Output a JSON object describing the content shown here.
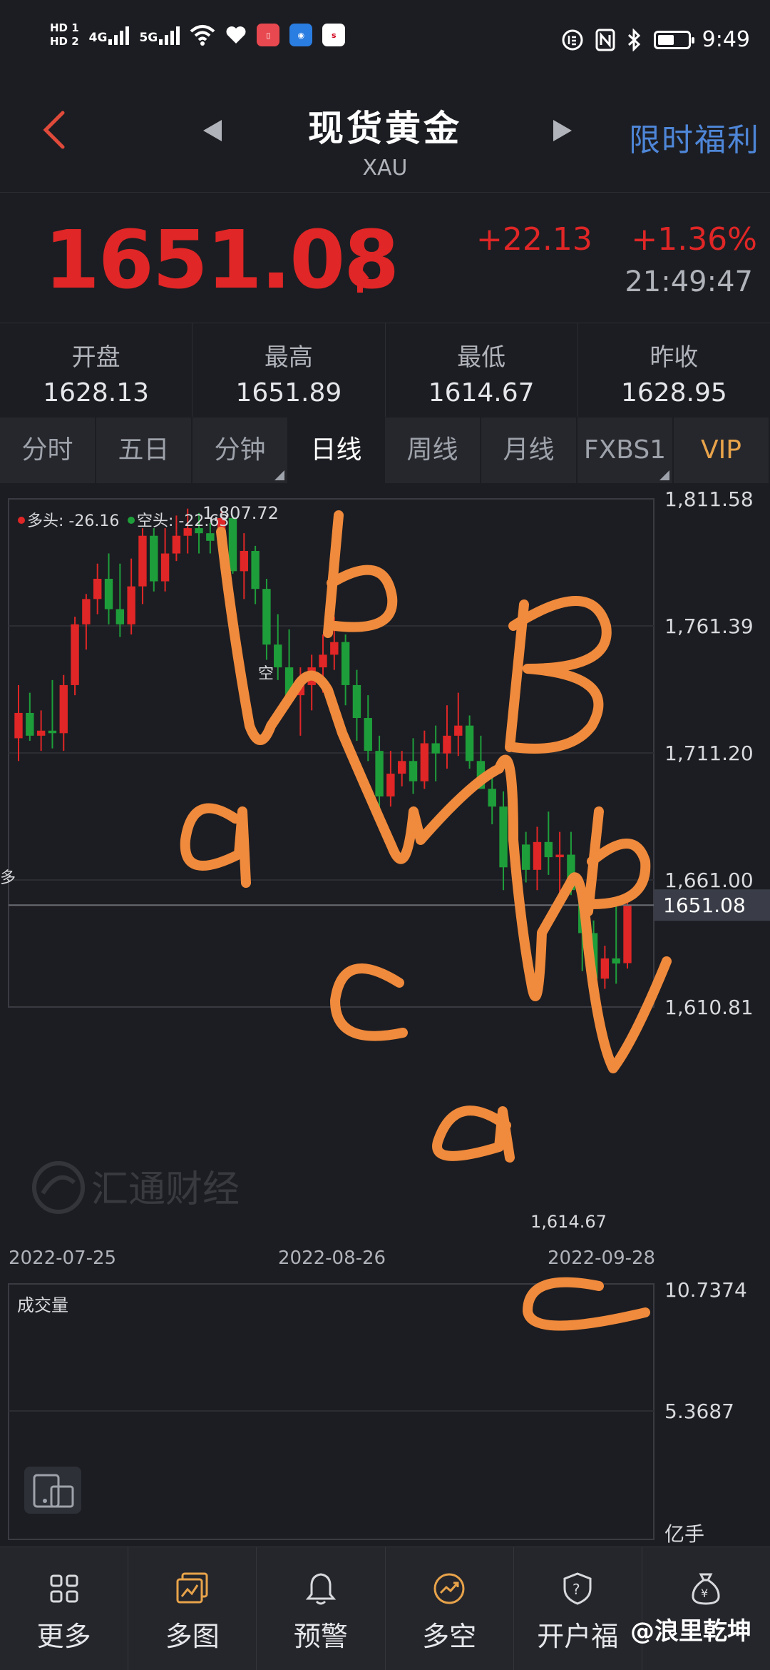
{
  "status_bar": {
    "hd1": "HD 1",
    "hd2": "HD 2",
    "net1": "4G",
    "net2": "5G",
    "time": "9:49"
  },
  "header": {
    "title": "现货黄金",
    "subtitle": "XAU",
    "promo": "限时福利"
  },
  "quote": {
    "price": "1651.08",
    "change": "+22.13",
    "change_pct": "+1.36%",
    "time": "21:49:47"
  },
  "stats": [
    {
      "label": "开盘",
      "value": "1628.13"
    },
    {
      "label": "最高",
      "value": "1651.89"
    },
    {
      "label": "最低",
      "value": "1614.67"
    },
    {
      "label": "昨收",
      "value": "1628.95"
    }
  ],
  "tabs": [
    "分时",
    "五日",
    "分钟",
    "日线",
    "周线",
    "月线",
    "FXBS1",
    "VIP"
  ],
  "chart_labels": {
    "long_legend": "多头: -26.16",
    "short_legend": "空头: -22.63",
    "high_mark": "1,807.72",
    "low_mark": "1,614.67",
    "kong_mark": "空",
    "duo_mark": "多",
    "current_tag": "1651.08",
    "watermark": "汇通财经",
    "volume_title": "成交量",
    "vol_unit": "亿手"
  },
  "chart_data": {
    "type": "candlestick",
    "y_ticks": [
      "1,811.58",
      "1,761.39",
      "1,711.20",
      "1,661.00",
      "1,610.81"
    ],
    "x_ticks": [
      "2022-07-25",
      "2022-08-26",
      "2022-09-28"
    ],
    "volume_ticks": [
      "10.7374",
      "5.3687"
    ],
    "ylim": [
      1610.81,
      1811.58
    ],
    "current": 1651.08,
    "candles": [
      {
        "o": 1717,
        "h": 1738,
        "l": 1708,
        "c": 1727
      },
      {
        "o": 1727,
        "h": 1735,
        "l": 1716,
        "c": 1718
      },
      {
        "o": 1718,
        "h": 1728,
        "l": 1712,
        "c": 1720
      },
      {
        "o": 1720,
        "h": 1740,
        "l": 1713,
        "c": 1719
      },
      {
        "o": 1719,
        "h": 1742,
        "l": 1712,
        "c": 1738
      },
      {
        "o": 1738,
        "h": 1765,
        "l": 1734,
        "c": 1762
      },
      {
        "o": 1762,
        "h": 1774,
        "l": 1752,
        "c": 1772
      },
      {
        "o": 1772,
        "h": 1786,
        "l": 1766,
        "c": 1780
      },
      {
        "o": 1780,
        "h": 1790,
        "l": 1762,
        "c": 1768
      },
      {
        "o": 1768,
        "h": 1786,
        "l": 1757,
        "c": 1762
      },
      {
        "o": 1762,
        "h": 1788,
        "l": 1758,
        "c": 1777
      },
      {
        "o": 1777,
        "h": 1800,
        "l": 1770,
        "c": 1797
      },
      {
        "o": 1797,
        "h": 1800,
        "l": 1775,
        "c": 1779
      },
      {
        "o": 1779,
        "h": 1800,
        "l": 1775,
        "c": 1790
      },
      {
        "o": 1790,
        "h": 1805,
        "l": 1787,
        "c": 1797
      },
      {
        "o": 1797,
        "h": 1807.72,
        "l": 1790,
        "c": 1800
      },
      {
        "o": 1800,
        "h": 1806,
        "l": 1790,
        "c": 1798
      },
      {
        "o": 1798,
        "h": 1802,
        "l": 1790,
        "c": 1795
      },
      {
        "o": 1795,
        "h": 1807,
        "l": 1787,
        "c": 1804
      },
      {
        "o": 1804,
        "h": 1805,
        "l": 1782,
        "c": 1783
      },
      {
        "o": 1783,
        "h": 1798,
        "l": 1772,
        "c": 1791
      },
      {
        "o": 1791,
        "h": 1793,
        "l": 1770,
        "c": 1776
      },
      {
        "o": 1776,
        "h": 1780,
        "l": 1748,
        "c": 1754
      },
      {
        "o": 1754,
        "h": 1766,
        "l": 1740,
        "c": 1745
      },
      {
        "o": 1745,
        "h": 1760,
        "l": 1733,
        "c": 1734
      },
      {
        "o": 1734,
        "h": 1745,
        "l": 1718,
        "c": 1738
      },
      {
        "o": 1738,
        "h": 1750,
        "l": 1728,
        "c": 1745
      },
      {
        "o": 1745,
        "h": 1758,
        "l": 1735,
        "c": 1750
      },
      {
        "o": 1750,
        "h": 1765,
        "l": 1744,
        "c": 1755
      },
      {
        "o": 1755,
        "h": 1758,
        "l": 1730,
        "c": 1738
      },
      {
        "o": 1738,
        "h": 1744,
        "l": 1716,
        "c": 1725
      },
      {
        "o": 1725,
        "h": 1734,
        "l": 1708,
        "c": 1712
      },
      {
        "o": 1712,
        "h": 1718,
        "l": 1688,
        "c": 1694
      },
      {
        "o": 1694,
        "h": 1712,
        "l": 1690,
        "c": 1703
      },
      {
        "o": 1703,
        "h": 1712,
        "l": 1698,
        "c": 1708
      },
      {
        "o": 1708,
        "h": 1717,
        "l": 1695,
        "c": 1700
      },
      {
        "o": 1700,
        "h": 1720,
        "l": 1697,
        "c": 1715
      },
      {
        "o": 1715,
        "h": 1722,
        "l": 1700,
        "c": 1711
      },
      {
        "o": 1711,
        "h": 1730,
        "l": 1705,
        "c": 1718
      },
      {
        "o": 1718,
        "h": 1735,
        "l": 1710,
        "c": 1722
      },
      {
        "o": 1722,
        "h": 1726,
        "l": 1705,
        "c": 1708
      },
      {
        "o": 1708,
        "h": 1718,
        "l": 1697,
        "c": 1697
      },
      {
        "o": 1697,
        "h": 1702,
        "l": 1683,
        "c": 1690
      },
      {
        "o": 1690,
        "h": 1696,
        "l": 1657,
        "c": 1666
      },
      {
        "o": 1666,
        "h": 1682,
        "l": 1656,
        "c": 1675
      },
      {
        "o": 1675,
        "h": 1680,
        "l": 1660,
        "c": 1665
      },
      {
        "o": 1665,
        "h": 1682,
        "l": 1657,
        "c": 1676
      },
      {
        "o": 1676,
        "h": 1688,
        "l": 1663,
        "c": 1670
      },
      {
        "o": 1670,
        "h": 1680,
        "l": 1655,
        "c": 1671
      },
      {
        "o": 1671,
        "h": 1680,
        "l": 1655,
        "c": 1657
      },
      {
        "o": 1657,
        "h": 1660,
        "l": 1625,
        "c": 1640
      },
      {
        "o": 1640,
        "h": 1645,
        "l": 1614.67,
        "c": 1622
      },
      {
        "o": 1622,
        "h": 1635,
        "l": 1618,
        "c": 1630
      },
      {
        "o": 1630,
        "h": 1652,
        "l": 1620,
        "c": 1628
      },
      {
        "o": 1628.13,
        "h": 1651.89,
        "l": 1626,
        "c": 1651.08
      }
    ]
  },
  "nav": [
    {
      "label": "更多",
      "icon": "grid-icon"
    },
    {
      "label": "多图",
      "icon": "multi-chart-icon"
    },
    {
      "label": "预警",
      "icon": "bell-icon"
    },
    {
      "label": "多空",
      "icon": "gauge-icon"
    },
    {
      "label": "开户福",
      "icon": "badge-icon"
    },
    {
      "label": "",
      "icon": "money-bag-icon"
    }
  ],
  "bottom_watermark": "@浪里乾坤",
  "annotations": [
    "b",
    "a",
    "c",
    "B",
    "b",
    "a",
    "c"
  ],
  "colors": {
    "up": "#e02626",
    "down": "#1e9e3a",
    "annotation": "#f08a3c",
    "accent": "#4e86d8",
    "vip": "#e8a34a"
  }
}
